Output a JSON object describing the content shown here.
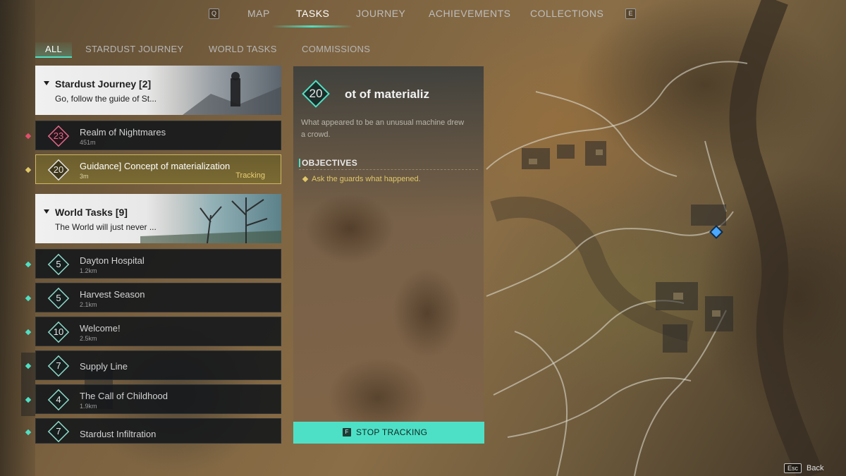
{
  "top_nav": {
    "left_key": "Q",
    "right_key": "E",
    "tabs": [
      {
        "label": "MAP",
        "active": false
      },
      {
        "label": "TASKS",
        "active": true
      },
      {
        "label": "JOURNEY",
        "active": false
      },
      {
        "label": "ACHIEVEMENTS",
        "active": false
      },
      {
        "label": "COLLECTIONS",
        "active": false
      }
    ]
  },
  "filter_tabs": [
    {
      "label": "ALL",
      "active": true
    },
    {
      "label": "STARDUST JOURNEY",
      "active": false
    },
    {
      "label": "WORLD TASKS",
      "active": false
    },
    {
      "label": "COMMISSIONS",
      "active": false
    }
  ],
  "groups": [
    {
      "title": "Stardust Journey [2]",
      "subtitle": "Go, follow the guide of St..."
    },
    {
      "title": "World Tasks [9]",
      "subtitle": "The World will just never ..."
    }
  ],
  "tasks": [
    {
      "level": "23",
      "name": "Realm of Nightmares",
      "distance": "451m",
      "tracked": false,
      "level_color": "#e06a8a",
      "marker_color": "#e0506a"
    },
    {
      "level": "20",
      "name": "Guidance] Concept of materialization",
      "distance": "3m",
      "tracked": true,
      "tracking_label": "Tracking",
      "level_color": "#e6e6e6",
      "marker_color": "#e0c766"
    },
    {
      "level": "5",
      "name": "Dayton Hospital",
      "distance": "1.2km",
      "tracked": false,
      "level_color": "#e6e6e6",
      "marker_color": "#4fe0c4"
    },
    {
      "level": "5",
      "name": "Harvest Season",
      "distance": "2.1km",
      "tracked": false,
      "level_color": "#e6e6e6",
      "marker_color": "#4fe0c4"
    },
    {
      "level": "10",
      "name": "Welcome!",
      "distance": "2.5km",
      "tracked": false,
      "level_color": "#e6e6e6",
      "marker_color": "#4fe0c4"
    },
    {
      "level": "7",
      "name": "Supply Line",
      "distance": "",
      "tracked": false,
      "level_color": "#e6e6e6",
      "marker_color": "#4fe0c4"
    },
    {
      "level": "4",
      "name": "The Call of Childhood",
      "distance": "1.9km",
      "tracked": false,
      "level_color": "#e6e6e6",
      "marker_color": "#4fe0c4"
    },
    {
      "level": "7",
      "name": "Stardust Infiltration",
      "distance": "",
      "tracked": false,
      "level_color": "#e6e6e6",
      "marker_color": "#4fe0c4"
    }
  ],
  "detail": {
    "level": "20",
    "title": "ot of materializ",
    "description": "What appeared to be an unusual machine drew a crowd.",
    "objectives_label": "OBJECTIVES",
    "objectives": [
      "Ask the guards what happened."
    ],
    "stop_tracking_key": "F",
    "stop_tracking_label": "STOP TRACKING"
  },
  "footer": {
    "back_key": "Esc",
    "back_label": "Back"
  },
  "colors": {
    "accent": "#4fe0c4",
    "tracking": "#e0c766",
    "danger": "#e0506a"
  }
}
